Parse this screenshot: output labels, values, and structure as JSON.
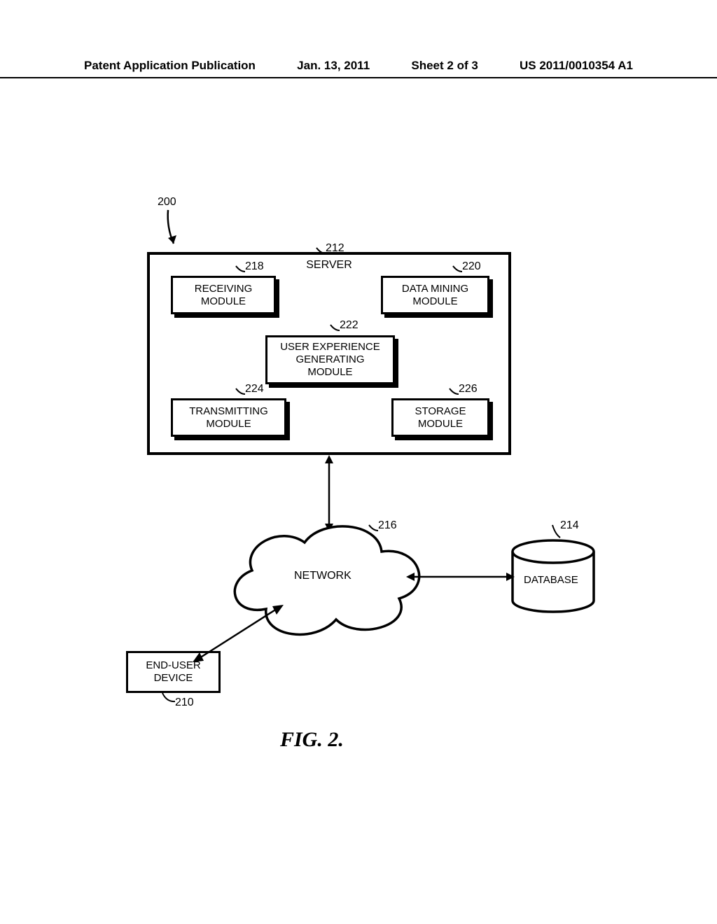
{
  "header": {
    "left": "Patent Application Publication",
    "mid_date": "Jan. 13, 2011",
    "mid_sheet": "Sheet 2 of 3",
    "right": "US 2011/0010354 A1"
  },
  "refs": {
    "fig": "200",
    "server": "212",
    "receiving": "218",
    "datamining": "220",
    "userexp": "222",
    "transmitting": "224",
    "storage": "226",
    "network": "216",
    "database": "214",
    "enduser": "210"
  },
  "labels": {
    "server": "SERVER",
    "receiving": "RECEIVING\nMODULE",
    "datamining": "DATA MINING\nMODULE",
    "userexp": "USER EXPERIENCE\nGENERATING\nMODULE",
    "transmitting": "TRANSMITTING\nMODULE",
    "storage": "STORAGE\nMODULE",
    "network": "NETWORK",
    "database": "DATABASE",
    "enduser": "END-USER\nDEVICE"
  },
  "caption": "FIG. 2."
}
